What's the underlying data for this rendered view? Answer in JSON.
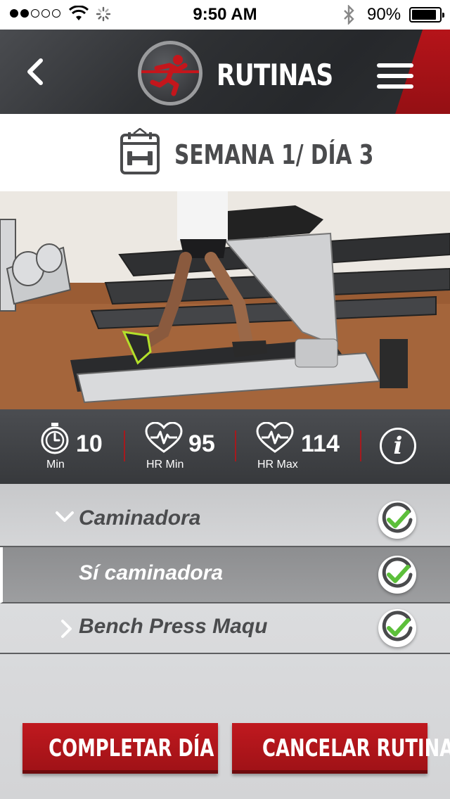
{
  "status_bar": {
    "signal_dots": [
      true,
      true,
      false,
      false,
      false
    ],
    "time": "9:50 AM",
    "battery": "90%",
    "battery_level": 0.9
  },
  "header": {
    "title": "RUTINAS",
    "back_icon": "chevron-left-icon",
    "menu_icon": "hamburger-menu-icon",
    "logo": "runner-logo",
    "accent_color": "#c4161c"
  },
  "week": {
    "label": "SEMANA 1/ DÍA 3",
    "icon": "calendar-dumbbell-icon"
  },
  "photo": {
    "subject": "person-on-treadmill"
  },
  "stats": {
    "time": {
      "value": "10",
      "caption": "Min",
      "icon": "stopwatch-icon"
    },
    "hr_min": {
      "value": "95",
      "caption": "HR Min",
      "icon": "heart-rate-icon"
    },
    "hr_max": {
      "value": "114",
      "caption": "HR Max",
      "icon": "heart-rate-icon"
    },
    "info_label": "i"
  },
  "exercises": [
    {
      "name": "Caminadora",
      "expanded": true,
      "completed": true
    },
    {
      "name": "Sí caminadora",
      "sub": true,
      "completed": true
    },
    {
      "name": "Bench Press Maqu",
      "expanded": false,
      "completed": true
    }
  ],
  "buttons": {
    "complete": "COMPLETAR DÍA",
    "cancel": "CANCELAR RUTINA"
  },
  "colors": {
    "check_green": "#5cbf3a",
    "button_red": "#b3161c"
  }
}
